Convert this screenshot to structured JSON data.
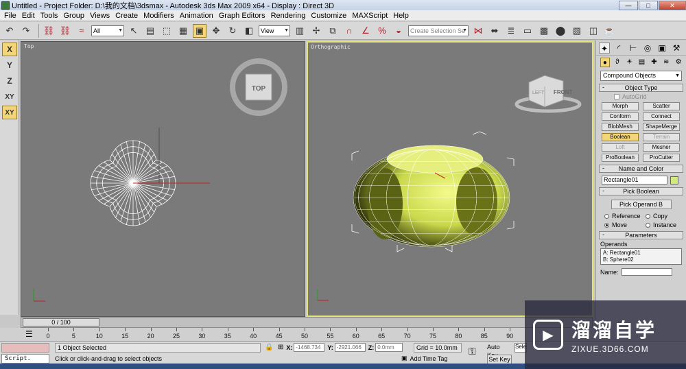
{
  "window": {
    "title": "Untitled    - Project Folder: D:\\我的文档\\3dsmax    - Autodesk 3ds Max  2009 x64     - Display : Direct 3D",
    "minimize": "—",
    "maximize": "□",
    "close": "✕"
  },
  "menu": [
    "File",
    "Edit",
    "Tools",
    "Group",
    "Views",
    "Create",
    "Modifiers",
    "Animation",
    "Graph Editors",
    "Rendering",
    "Customize",
    "MAXScript",
    "Help"
  ],
  "toolbar": {
    "filter": "All",
    "refcoord": "View",
    "selection_set_placeholder": "Create Selection Se"
  },
  "axis_buttons": [
    "X",
    "Y",
    "Z",
    "XY",
    "XY"
  ],
  "viewports": {
    "top_label": "Top",
    "ortho_label": "Orthographic",
    "viewcube_top": "TOP",
    "viewcube_front": "FRONT",
    "viewcube_left": "LEFT"
  },
  "timeline": {
    "frame": "0 / 100",
    "ticks": [
      "0",
      "5",
      "10",
      "15",
      "20",
      "25",
      "30",
      "35",
      "40",
      "45",
      "50",
      "55",
      "60",
      "65",
      "70",
      "75",
      "80",
      "85",
      "90"
    ]
  },
  "status": {
    "script": "Script.",
    "selected": "1 Object Selected",
    "prompt": "Click or click-and-drag to select objects",
    "x_label": "X:",
    "x_val": "-1468.734",
    "y_label": "Y:",
    "y_val": "-2921.066",
    "z_label": "Z:",
    "z_val": "0.0mm",
    "grid": "Grid = 10.0mm",
    "add_time_tag": "Add Time Tag",
    "auto_key": "Auto Key",
    "set_key": "Set Key",
    "selected_field": "Sele"
  },
  "command_panel": {
    "category": "Compound Objects",
    "object_type": "Object Type",
    "autogrid": "AutoGrid",
    "buttons": [
      "Morph",
      "Scatter",
      "Conform",
      "Connect",
      "BlobMesh",
      "ShapeMerge",
      "Boolean",
      "Terrain",
      "Loft",
      "Mesher",
      "ProBoolean",
      "ProCutter"
    ],
    "name_and_color": "Name and Color",
    "object_name": "Rectangle01",
    "pick_boolean": "Pick Boolean",
    "pick_operand": "Pick Operand B",
    "radio_reference": "Reference",
    "radio_copy": "Copy",
    "radio_move": "Move",
    "radio_instance": "Instance",
    "parameters": "Parameters",
    "operands": "Operands",
    "operand_a": "A: Rectangle01",
    "operand_b": "B: Sphere02",
    "name_label": "Name:",
    "swatch_color": "#d2ea7a"
  },
  "watermark": {
    "title": "溜溜自学",
    "url": "ZIXUE.3D66.COM"
  }
}
